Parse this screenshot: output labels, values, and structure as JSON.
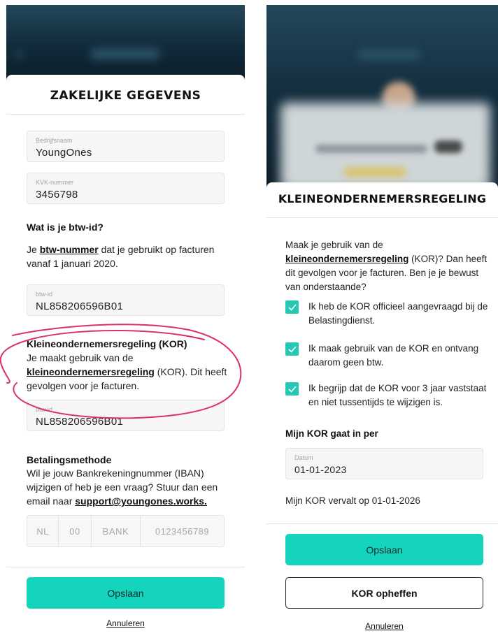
{
  "left_screen": {
    "sheet_title": "ZAKELIJKE GEGEVENS",
    "company_field": {
      "label": "Bedrijfsnaam",
      "value": "YoungOnes"
    },
    "kvk_field": {
      "label": "KVK-nummer",
      "value": "3456798"
    },
    "vat_section": {
      "heading": "Wat is je btw-id?",
      "text_prefix": "Je ",
      "link": "btw-nummer",
      "text_suffix": " dat je gebruikt op facturen vanaf 1 januari 2020."
    },
    "vat_field": {
      "label": "btw-id",
      "value": "NL858206596B01"
    },
    "kor_section": {
      "heading": "Kleineondernemersregeling (KOR)",
      "text_prefix": "Je maakt gebruik van de ",
      "link": "kleineondernemersregeling",
      "text_suffix": " (KOR). Dit heeft gevolgen voor je facturen."
    },
    "vat_field_2": {
      "label": "btw-id",
      "value": "NL858206596B01"
    },
    "payment_section": {
      "heading": "Betalingsmethode",
      "text": "Wil je jouw Bankrekeningnummer (IBAN) wijzigen of heb je een vraag? Stuur dan een email naar ",
      "link": "support@youngones.works."
    },
    "iban": {
      "country": "NL",
      "check": "00",
      "bank": "BANK",
      "account": "0123456789"
    },
    "save_label": "Opslaan",
    "cancel_label": "Annuleren"
  },
  "right_screen": {
    "sheet_title": "KLEINEONDERNEMERSREGELING",
    "intro": {
      "text_prefix": "Maak je gebruik van de ",
      "link": "kleineondernemersregeling",
      "text_suffix": " (KOR)? Dan heeft dit gevolgen voor je facturen. Ben je je bewust van onderstaande?"
    },
    "checklist": [
      {
        "label": "Ik heb de KOR officieel aangevraagd bij de Belastingdienst.",
        "checked": true
      },
      {
        "label": "Ik maak gebruik van de KOR en ontvang daarom geen btw.",
        "checked": true
      },
      {
        "label": "Ik begrijp dat de KOR voor 3 jaar vaststaat en niet tussentijds te wijzigen is.",
        "checked": true
      }
    ],
    "start_heading": "Mijn KOR gaat in per",
    "date_field": {
      "label": "Datum",
      "value": "01-01-2023"
    },
    "expiry_text": "Mijn KOR vervalt op 01-01-2026",
    "save_label": "Opslaan",
    "stop_label": "KOR opheffen",
    "cancel_label": "Annuleren"
  },
  "colors": {
    "accent": "#14d4be",
    "checkbox": "#25c8b4",
    "annotation": "#d9316e",
    "backdrop": "#112a3a"
  }
}
